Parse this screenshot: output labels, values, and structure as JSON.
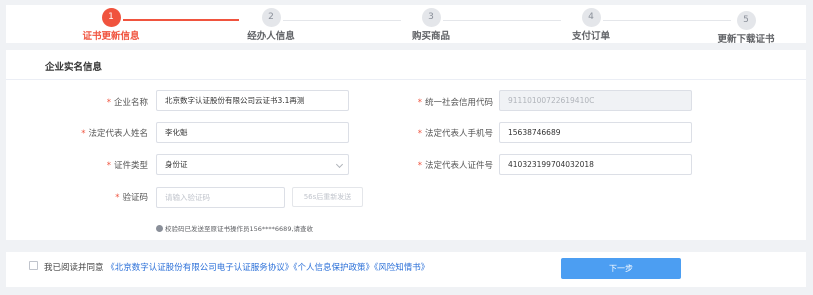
{
  "steps": [
    {
      "num": "1",
      "label": "证书更新信息"
    },
    {
      "num": "2",
      "label": "经办人信息"
    },
    {
      "num": "3",
      "label": "购买商品"
    },
    {
      "num": "4",
      "label": "支付订单"
    },
    {
      "num": "5",
      "label": "更新下载证书"
    }
  ],
  "progress": {
    "current_step": 1,
    "total_steps": 5
  },
  "section": {
    "title": "企业实名信息"
  },
  "form": {
    "required_mark": "*",
    "company_name": {
      "label": "企业名称",
      "value": "北京数字认证股份有限公司云证书3.1再测"
    },
    "credit_code": {
      "label": "统一社会信用代码",
      "value": "91110100722619410C"
    },
    "legal_rep_name": {
      "label": "法定代表人姓名",
      "value": "李化魁"
    },
    "legal_rep_phone": {
      "label": "法定代表人手机号",
      "value": "15638746689"
    },
    "id_type": {
      "label": "证件类型",
      "value": "身份证"
    },
    "legal_rep_id": {
      "label": "法定代表人证件号",
      "value": "410323199704032018"
    },
    "verify_code": {
      "label": "验证码",
      "placeholder": "请输入验证码",
      "resend_label": "56s后重新发送"
    },
    "hint": "校验码已发送至原证书操作员156****6689,请查收"
  },
  "footer": {
    "agree_prefix": "我已阅读并同意",
    "docs": [
      "《北京数字认证股份有限公司电子认证服务协议》",
      "《个人信息保护政策》",
      "《风险知情书》"
    ],
    "next_label": "下一步"
  },
  "colors": {
    "accent": "#f0533e",
    "primary": "#4c9ef2",
    "link": "#2a6fd8"
  }
}
